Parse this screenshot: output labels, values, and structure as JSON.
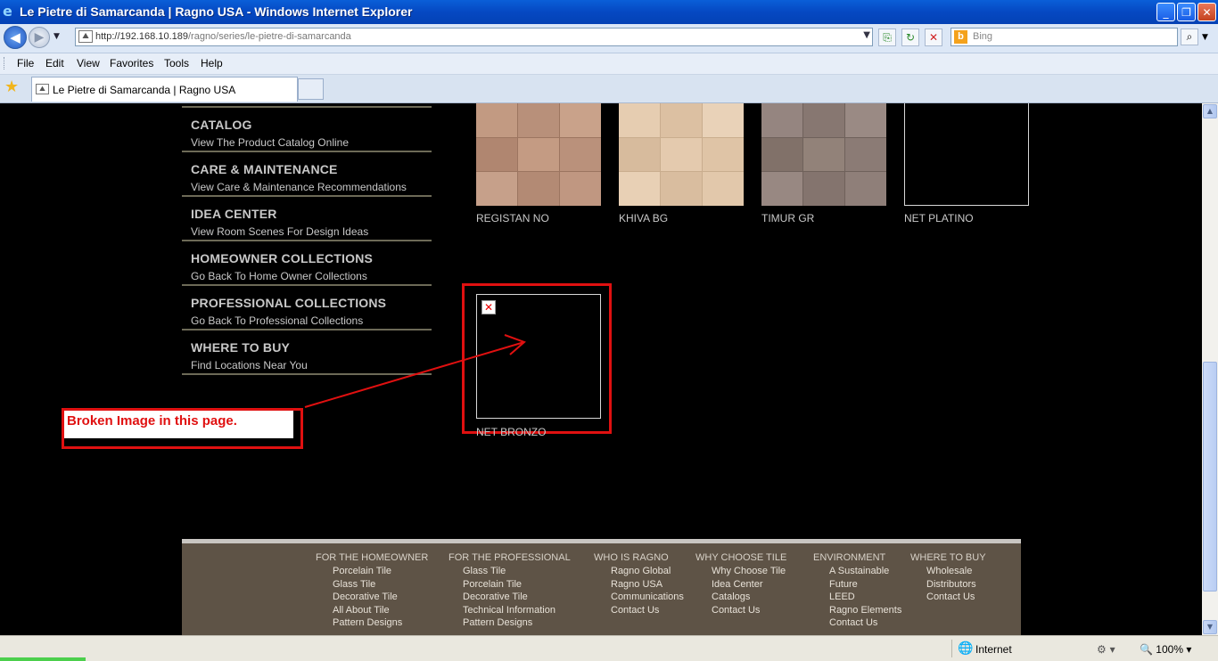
{
  "window": {
    "title": "Le Pietre di Samarcanda | Ragno USA - Windows Internet Explorer"
  },
  "nav": {
    "url_host": "http://192.168.10.189",
    "url_path": "/ragno/series/le-pietre-di-samarcanda",
    "search_placeholder": "Bing"
  },
  "menu": [
    "File",
    "Edit",
    "View",
    "Favorites",
    "Tools",
    "Help"
  ],
  "tab": {
    "label": "Le Pietre di Samarcanda | Ragno USA"
  },
  "sidebar": [
    {
      "title": "CATALOG",
      "sub": "View The Product Catalog Online"
    },
    {
      "title": "CARE & MAINTENANCE",
      "sub": "View Care & Maintenance Recommendations"
    },
    {
      "title": "IDEA CENTER",
      "sub": "View Room Scenes For Design Ideas"
    },
    {
      "title": "HOMEOWNER COLLECTIONS",
      "sub": "Go Back To Home Owner Collections"
    },
    {
      "title": "PROFESSIONAL COLLECTIONS",
      "sub": "Go Back To Professional Collections"
    },
    {
      "title": "WHERE TO BUY",
      "sub": "Find Locations Near You"
    }
  ],
  "tiles": [
    {
      "name": "REGISTAN NO",
      "color": "#b98d75"
    },
    {
      "name": "KHIVA BG",
      "color": "#ddc1a3"
    },
    {
      "name": "TIMUR GR",
      "color": "#8a7a74"
    },
    {
      "name": "NET PLATINO",
      "color": "#000000"
    }
  ],
  "broken_tile": {
    "name": "NET BRONZO"
  },
  "annotation": {
    "text": "Broken Image in this page."
  },
  "footer": {
    "columns": [
      {
        "heading": "FOR THE HOMEOWNER",
        "links": [
          "Porcelain Tile",
          "Glass Tile",
          "Decorative Tile",
          "All About Tile",
          "Pattern Designs"
        ]
      },
      {
        "heading": "FOR THE PROFESSIONAL",
        "links": [
          "Glass Tile",
          "Porcelain Tile",
          "Decorative Tile",
          "Technical Information",
          "Pattern Designs"
        ]
      },
      {
        "heading": "WHO IS RAGNO",
        "links": [
          "Ragno Global",
          "Ragno USA",
          "Communications",
          "Contact Us"
        ]
      },
      {
        "heading": "WHY CHOOSE TILE",
        "links": [
          "Why Choose Tile",
          "Idea Center",
          "Catalogs",
          "Contact Us"
        ]
      },
      {
        "heading": "ENVIRONMENT",
        "links": [
          "A Sustainable",
          "Future",
          "LEED",
          "Ragno Elements",
          "Contact Us"
        ]
      },
      {
        "heading": "WHERE TO BUY",
        "links": [
          "Wholesale",
          "Distributors",
          "Contact Us"
        ]
      }
    ]
  },
  "status": {
    "zone": "Internet",
    "zoom": "100%"
  }
}
